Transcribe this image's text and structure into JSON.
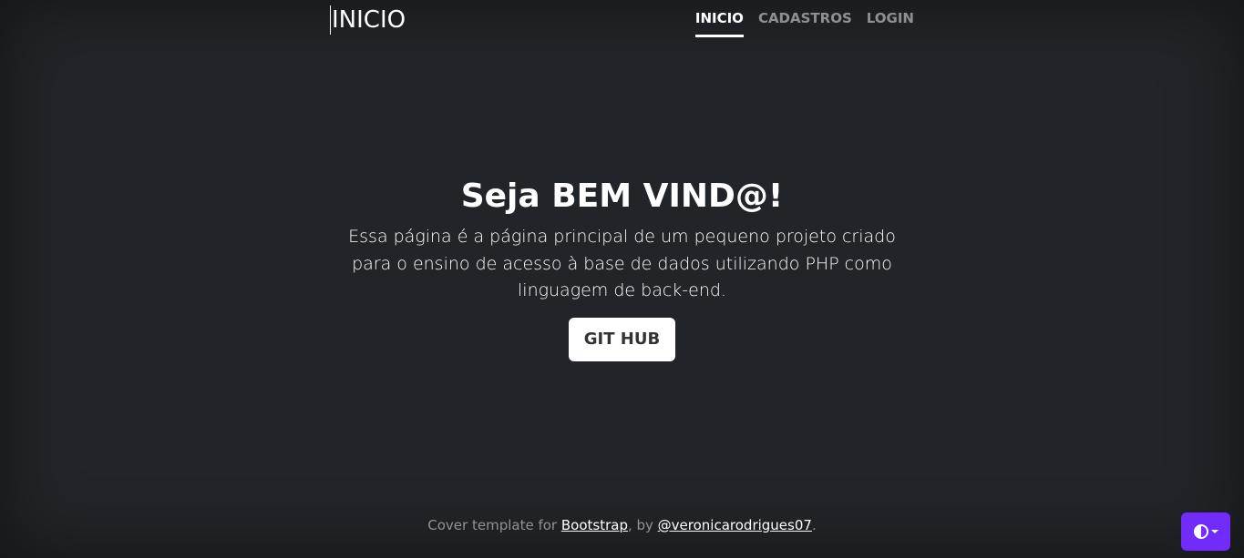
{
  "header": {
    "brand": "INICIO",
    "nav": [
      {
        "label": "INICIO",
        "active": true
      },
      {
        "label": "CADASTROS",
        "active": false
      },
      {
        "label": "LOGIN",
        "active": false
      }
    ]
  },
  "hero": {
    "title": "Seja BEM VIND@!",
    "description": "Essa página é a página principal de um pequeno projeto criado para o ensino de acesso à base de dados utilizando PHP como linguagem de back-end.",
    "button_label": "GIT HUB"
  },
  "footer": {
    "prefix": "Cover template for ",
    "link1": "Bootstrap",
    "middle": ", by ",
    "link2": "@veronicarodrigues07",
    "suffix": "."
  },
  "theme_toggle": {
    "icon": "circle-half-icon",
    "color": "#712cf9"
  },
  "colors": {
    "background": "#212529",
    "accent": "#712cf9"
  }
}
